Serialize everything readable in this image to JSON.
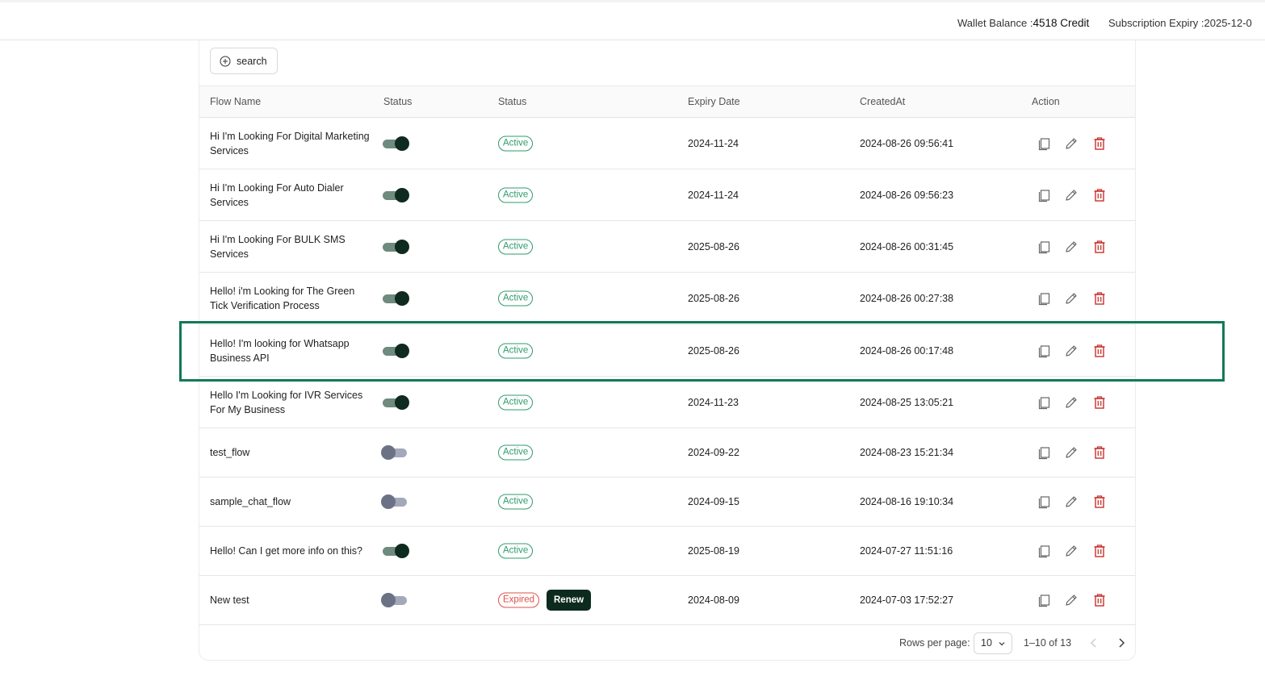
{
  "header": {
    "wallet_label": "Wallet Balance :",
    "wallet_value": "4518 Credit",
    "expiry_label": "Subscription Expiry :",
    "expiry_value": "2025-12-0"
  },
  "toolbar": {
    "search_label": "search"
  },
  "table": {
    "columns": [
      "Flow Name",
      "Status",
      "Status",
      "Expiry Date",
      "CreatedAt",
      "Action"
    ],
    "rows": [
      {
        "name": "Hi I'm Looking For Digital Marketing Services",
        "enabled": true,
        "status": "Active",
        "expiry": "2024-11-24",
        "created": "2024-08-26 09:56:41"
      },
      {
        "name": "Hi I'm Looking For Auto Dialer Services",
        "enabled": true,
        "status": "Active",
        "expiry": "2024-11-24",
        "created": "2024-08-26 09:56:23"
      },
      {
        "name": "Hi I'm Looking For BULK SMS Services",
        "enabled": true,
        "status": "Active",
        "expiry": "2025-08-26",
        "created": "2024-08-26 00:31:45"
      },
      {
        "name": "Hello! i'm Looking for The Green Tick Verification Process",
        "enabled": true,
        "status": "Active",
        "expiry": "2025-08-26",
        "created": "2024-08-26 00:27:38"
      },
      {
        "name": "Hello! I'm looking for Whatsapp Business API",
        "enabled": true,
        "status": "Active",
        "expiry": "2025-08-26",
        "created": "2024-08-26 00:17:48"
      },
      {
        "name": "Hello I'm Looking for IVR Services For My Business",
        "enabled": true,
        "status": "Active",
        "expiry": "2024-11-23",
        "created": "2024-08-25 13:05:21"
      },
      {
        "name": "test_flow",
        "enabled": false,
        "status": "Active",
        "expiry": "2024-09-22",
        "created": "2024-08-23 15:21:34"
      },
      {
        "name": "sample_chat_flow",
        "enabled": false,
        "status": "Active",
        "expiry": "2024-09-15",
        "created": "2024-08-16 19:10:34"
      },
      {
        "name": "Hello! Can I get more info on this?",
        "enabled": true,
        "status": "Active",
        "expiry": "2025-08-19",
        "created": "2024-07-27 11:51:16"
      },
      {
        "name": "New test",
        "enabled": false,
        "status": "Expired",
        "renew_label": "Renew",
        "expiry": "2024-08-09",
        "created": "2024-07-03 17:52:27"
      }
    ]
  },
  "pagination": {
    "rows_per_page_label": "Rows per page:",
    "rows_per_page_value": "10",
    "range_text": "1–10 of 13"
  },
  "colors": {
    "highlight": "#127a55",
    "active": "#2e9b6c",
    "expired": "#e0504a",
    "toggle_on": "#0f2a1f",
    "delete_icon": "#c9302c"
  },
  "icons": [
    "plus-circle-icon",
    "copy-icon",
    "edit-icon",
    "delete-icon",
    "chevron-down-icon",
    "chevron-left-icon",
    "chevron-right-icon"
  ]
}
